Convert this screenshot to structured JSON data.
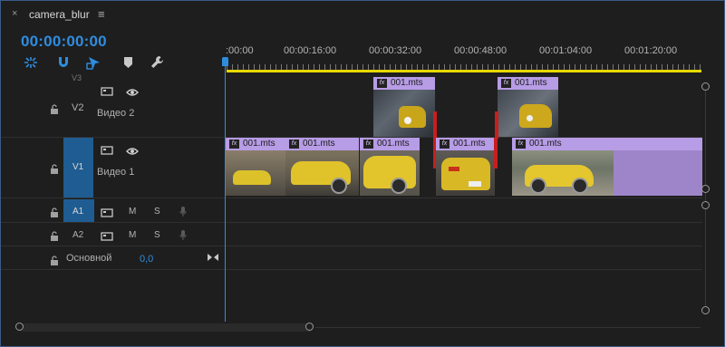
{
  "tab": {
    "close": "×",
    "title": "camera_blur",
    "menu": "≡"
  },
  "timecode": "00:00:00:00",
  "toolbar": [
    "snap-icon",
    "magnet-icon",
    "linked-selection-icon",
    "marker-icon",
    "wrench-icon"
  ],
  "ruler": {
    "labels": [
      ":00:00",
      "00:00:16:00",
      "00:00:32:00",
      "00:00:48:00",
      "00:01:04:00",
      "00:01:20:00"
    ]
  },
  "tracks": {
    "v3": {
      "label": "V3"
    },
    "v2": {
      "label": "V2",
      "name": "Видео 2"
    },
    "v1": {
      "label": "V1",
      "name": "Видео 1"
    },
    "a1": {
      "label": "A1",
      "m": "M",
      "s": "S"
    },
    "a2": {
      "label": "A2",
      "m": "M",
      "s": "S"
    },
    "master": {
      "name": "Основной",
      "value": "0,0"
    }
  },
  "clips": {
    "fx": "fx",
    "name": "001.mts"
  },
  "colors": {
    "accent": "#2f8de0",
    "clip": "#9e85c9",
    "clip_header": "#b79ce6",
    "target": "#1f5c92",
    "work_area": "#e8d800",
    "transition": "#c81e1e"
  }
}
